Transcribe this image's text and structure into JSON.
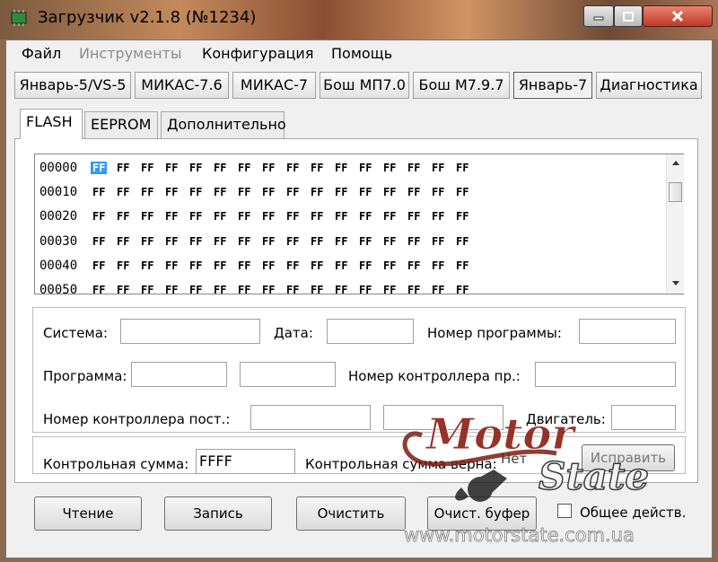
{
  "window": {
    "title": "Загрузчик v2.1.8 (№1234)"
  },
  "menu": {
    "file": "Файл",
    "tools": "Инструменты",
    "config": "Конфигурация",
    "help": "Помощь"
  },
  "device_tabs": [
    "Январь-5/VS-5",
    "МИКАС-7.6",
    "МИКАС-7",
    "Бош МП7.0",
    "Бош М7.9.7",
    "Январь-7",
    "Диагностика"
  ],
  "sub_tabs": [
    "FLASH",
    "EEPROM",
    "Дополнительно"
  ],
  "hex": {
    "addresses": [
      "00000",
      "00010",
      "00020",
      "00030",
      "00040",
      "00050"
    ],
    "byte": "FF"
  },
  "info": {
    "system_label": "Система:",
    "date_label": "Дата:",
    "program_number_label": "Номер программы:",
    "program_label": "Программа:",
    "controller_number_pr_label": "Номер контроллера пр.:",
    "controller_number_post_label": "Номер контроллера пост.:",
    "engine_label": "Двигатель:"
  },
  "checksum": {
    "label": "Контрольная сумма:",
    "value": "FFFF",
    "valid_label": "Контрольная сумма верна:",
    "valid_value": "Нет",
    "fix_button": "Исправить"
  },
  "actions": {
    "read": "Чтение",
    "write": "Запись",
    "clear": "Очистить",
    "clear_buffer": "Очист. буфер",
    "common_action": "Общее действ."
  },
  "watermark": {
    "line1": "Motor",
    "line2": "State",
    "url": "www.motorstate.com.ua"
  }
}
